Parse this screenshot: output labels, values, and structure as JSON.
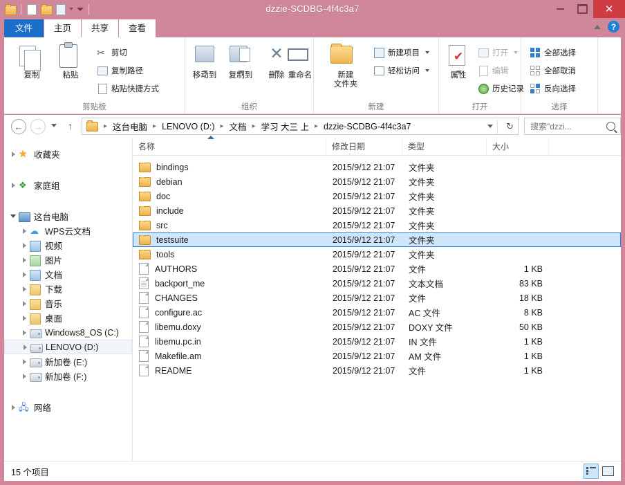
{
  "window": {
    "title": "dzzie-SCDBG-4f4c3a7",
    "titlebar_color": "#cf8799",
    "close_color": "#cd3c41",
    "minimize_label": "",
    "maximize_label": "",
    "close_label": "✕"
  },
  "quick_access": {
    "items": [
      {
        "name": "folder-icon",
        "label": ""
      },
      {
        "name": "new-folder-icon",
        "label": ""
      },
      {
        "name": "folder-properties-icon",
        "label": ""
      },
      {
        "name": "properties-icon",
        "label": ""
      }
    ],
    "dropdown_label": ""
  },
  "tabs": [
    {
      "id": "file",
      "label": "文件",
      "active": true,
      "accent": "#1c6fc9"
    },
    {
      "id": "home",
      "label": "主页",
      "active": false
    },
    {
      "id": "share",
      "label": "共享",
      "active": false
    },
    {
      "id": "view",
      "label": "查看",
      "active": false
    }
  ],
  "ribbon_right": {
    "collapse_label": "",
    "help_label": "?"
  },
  "ribbon": {
    "groups": [
      {
        "id": "clipboard",
        "label": "剪贴板",
        "big_buttons": [
          {
            "name": "copy-button",
            "label": "复制",
            "icon": "copy-icon"
          },
          {
            "name": "paste-button",
            "label": "粘贴",
            "icon": "clipboard-icon"
          }
        ],
        "small_buttons": [
          {
            "name": "cut-button",
            "label": "剪切",
            "icon": "scissors-icon",
            "dimmed": false
          },
          {
            "name": "copy-path-button",
            "label": "复制路径",
            "icon": "copy-path-icon",
            "dimmed": false
          },
          {
            "name": "paste-shortcut-button",
            "label": "粘贴快捷方式",
            "icon": "paste-shortcut-icon",
            "dimmed": false
          }
        ]
      },
      {
        "id": "organize",
        "label": "组织",
        "big_buttons": [
          {
            "name": "move-to-button",
            "label": "移动到",
            "icon": "move-to-icon"
          },
          {
            "name": "copy-to-button",
            "label": "复制到",
            "icon": "copy-to-icon"
          },
          {
            "name": "delete-button",
            "label": "删除",
            "icon": "delete-x-icon"
          },
          {
            "name": "rename-button",
            "label": "重命名",
            "icon": "rename-icon"
          }
        ],
        "small_buttons": []
      },
      {
        "id": "new",
        "label": "新建",
        "big_buttons": [
          {
            "name": "new-folder-button",
            "label": "新建\n文件夹",
            "label_line1": "新建",
            "label_line2": "文件夹",
            "icon": "new-folder-icon"
          }
        ],
        "small_buttons": [
          {
            "name": "new-item-button",
            "label": "新建项目",
            "icon": "new-item-icon",
            "caret": true
          },
          {
            "name": "easy-access-button",
            "label": "轻松访问",
            "icon": "easy-access-icon",
            "caret": true
          }
        ]
      },
      {
        "id": "open",
        "label": "打开",
        "big_buttons": [
          {
            "name": "properties-button",
            "label": "属性",
            "icon": "properties-icon"
          }
        ],
        "small_buttons": [
          {
            "name": "open-button",
            "label": "打开",
            "icon": "open-icon",
            "caret": true,
            "dimmed": true
          },
          {
            "name": "edit-button",
            "label": "编辑",
            "icon": "edit-icon",
            "dimmed": true
          },
          {
            "name": "history-button",
            "label": "历史记录",
            "icon": "history-icon",
            "dimmed": false
          }
        ]
      },
      {
        "id": "select",
        "label": "选择",
        "big_buttons": [],
        "small_buttons": [
          {
            "name": "select-all-button",
            "label": "全部选择",
            "icon": "select-all-icon"
          },
          {
            "name": "select-none-button",
            "label": "全部取消",
            "icon": "select-none-icon"
          },
          {
            "name": "invert-selection-button",
            "label": "反向选择",
            "icon": "invert-selection-icon"
          }
        ]
      }
    ]
  },
  "address_bar": {
    "back_label": "←",
    "forward_label": "→",
    "up_label": "↑",
    "refresh_label": "↻",
    "breadcrumbs": [
      "这台电脑",
      "LENOVO (D:)",
      "文档",
      "学习 大三 上",
      "dzzie-SCDBG-4f4c3a7"
    ],
    "separator": "▸"
  },
  "search": {
    "placeholder": "搜索\"dzzi...",
    "value": ""
  },
  "nav_pane": {
    "items": [
      {
        "label": "收藏夹",
        "icon": "star-icon",
        "indent": false,
        "twisty": "closed",
        "selected": false,
        "spacer_after": true
      },
      {
        "label": "家庭组",
        "icon": "homegroup-icon",
        "indent": false,
        "twisty": "closed",
        "selected": false,
        "spacer_after": true
      },
      {
        "label": "这台电脑",
        "icon": "this-pc-icon",
        "indent": false,
        "twisty": "open",
        "selected": false
      },
      {
        "label": "WPS云文档",
        "icon": "cloud-icon",
        "indent": true,
        "twisty": "closed",
        "selected": false
      },
      {
        "label": "视频",
        "icon": "videos-icon",
        "indent": true,
        "twisty": "closed",
        "selected": false
      },
      {
        "label": "图片",
        "icon": "pictures-icon",
        "indent": true,
        "twisty": "closed",
        "selected": false
      },
      {
        "label": "文档",
        "icon": "documents-icon",
        "indent": true,
        "twisty": "closed",
        "selected": false
      },
      {
        "label": "下载",
        "icon": "downloads-icon",
        "indent": true,
        "twisty": "closed",
        "selected": false
      },
      {
        "label": "音乐",
        "icon": "music-icon",
        "indent": true,
        "twisty": "closed",
        "selected": false
      },
      {
        "label": "桌面",
        "icon": "desktop-icon",
        "indent": true,
        "twisty": "closed",
        "selected": false
      },
      {
        "label": "Windows8_OS (C:)",
        "icon": "system-drive-icon",
        "indent": true,
        "twisty": "closed",
        "selected": false
      },
      {
        "label": "LENOVO (D:)",
        "icon": "drive-icon",
        "indent": true,
        "twisty": "closed",
        "selected": true
      },
      {
        "label": "新加卷 (E:)",
        "icon": "drive-icon",
        "indent": true,
        "twisty": "closed",
        "selected": false
      },
      {
        "label": "新加卷 (F:)",
        "icon": "drive-icon",
        "indent": true,
        "twisty": "closed",
        "selected": false,
        "spacer_after": true
      },
      {
        "label": "网络",
        "icon": "network-icon",
        "indent": false,
        "twisty": "closed",
        "selected": false
      }
    ]
  },
  "file_list": {
    "columns": [
      {
        "id": "name",
        "label": "名称",
        "sorted": true,
        "sort_dir": "asc"
      },
      {
        "id": "date",
        "label": "修改日期"
      },
      {
        "id": "type",
        "label": "类型"
      },
      {
        "id": "size",
        "label": "大小"
      }
    ],
    "rows": [
      {
        "name": "bindings",
        "date": "2015/9/12 21:07",
        "type": "文件夹",
        "size": "",
        "icon": "folder-icon",
        "selected": false
      },
      {
        "name": "debian",
        "date": "2015/9/12 21:07",
        "type": "文件夹",
        "size": "",
        "icon": "folder-icon",
        "selected": false
      },
      {
        "name": "doc",
        "date": "2015/9/12 21:07",
        "type": "文件夹",
        "size": "",
        "icon": "folder-icon",
        "selected": false
      },
      {
        "name": "include",
        "date": "2015/9/12 21:07",
        "type": "文件夹",
        "size": "",
        "icon": "folder-icon",
        "selected": false
      },
      {
        "name": "src",
        "date": "2015/9/12 21:07",
        "type": "文件夹",
        "size": "",
        "icon": "folder-icon",
        "selected": false
      },
      {
        "name": "testsuite",
        "date": "2015/9/12 21:07",
        "type": "文件夹",
        "size": "",
        "icon": "folder-icon",
        "selected": true
      },
      {
        "name": "tools",
        "date": "2015/9/12 21:07",
        "type": "文件夹",
        "size": "",
        "icon": "folder-icon",
        "selected": false
      },
      {
        "name": "AUTHORS",
        "date": "2015/9/12 21:07",
        "type": "文件",
        "size": "1 KB",
        "icon": "file-icon",
        "selected": false
      },
      {
        "name": "backport_me",
        "date": "2015/9/12 21:07",
        "type": "文本文档",
        "size": "83 KB",
        "icon": "text-file-icon",
        "selected": false
      },
      {
        "name": "CHANGES",
        "date": "2015/9/12 21:07",
        "type": "文件",
        "size": "18 KB",
        "icon": "file-icon",
        "selected": false
      },
      {
        "name": "configure.ac",
        "date": "2015/9/12 21:07",
        "type": "AC 文件",
        "size": "8 KB",
        "icon": "file-icon",
        "selected": false
      },
      {
        "name": "libemu.doxy",
        "date": "2015/9/12 21:07",
        "type": "DOXY 文件",
        "size": "50 KB",
        "icon": "file-icon",
        "selected": false
      },
      {
        "name": "libemu.pc.in",
        "date": "2015/9/12 21:07",
        "type": "IN 文件",
        "size": "1 KB",
        "icon": "file-icon",
        "selected": false
      },
      {
        "name": "Makefile.am",
        "date": "2015/9/12 21:07",
        "type": "AM 文件",
        "size": "1 KB",
        "icon": "file-icon",
        "selected": false
      },
      {
        "name": "README",
        "date": "2015/9/12 21:07",
        "type": "文件",
        "size": "1 KB",
        "icon": "file-icon",
        "selected": false
      }
    ]
  },
  "status_bar": {
    "item_count_text": "15 个项目",
    "views": [
      {
        "name": "details-view-button",
        "active": true
      },
      {
        "name": "large-icons-view-button",
        "active": false
      }
    ]
  }
}
